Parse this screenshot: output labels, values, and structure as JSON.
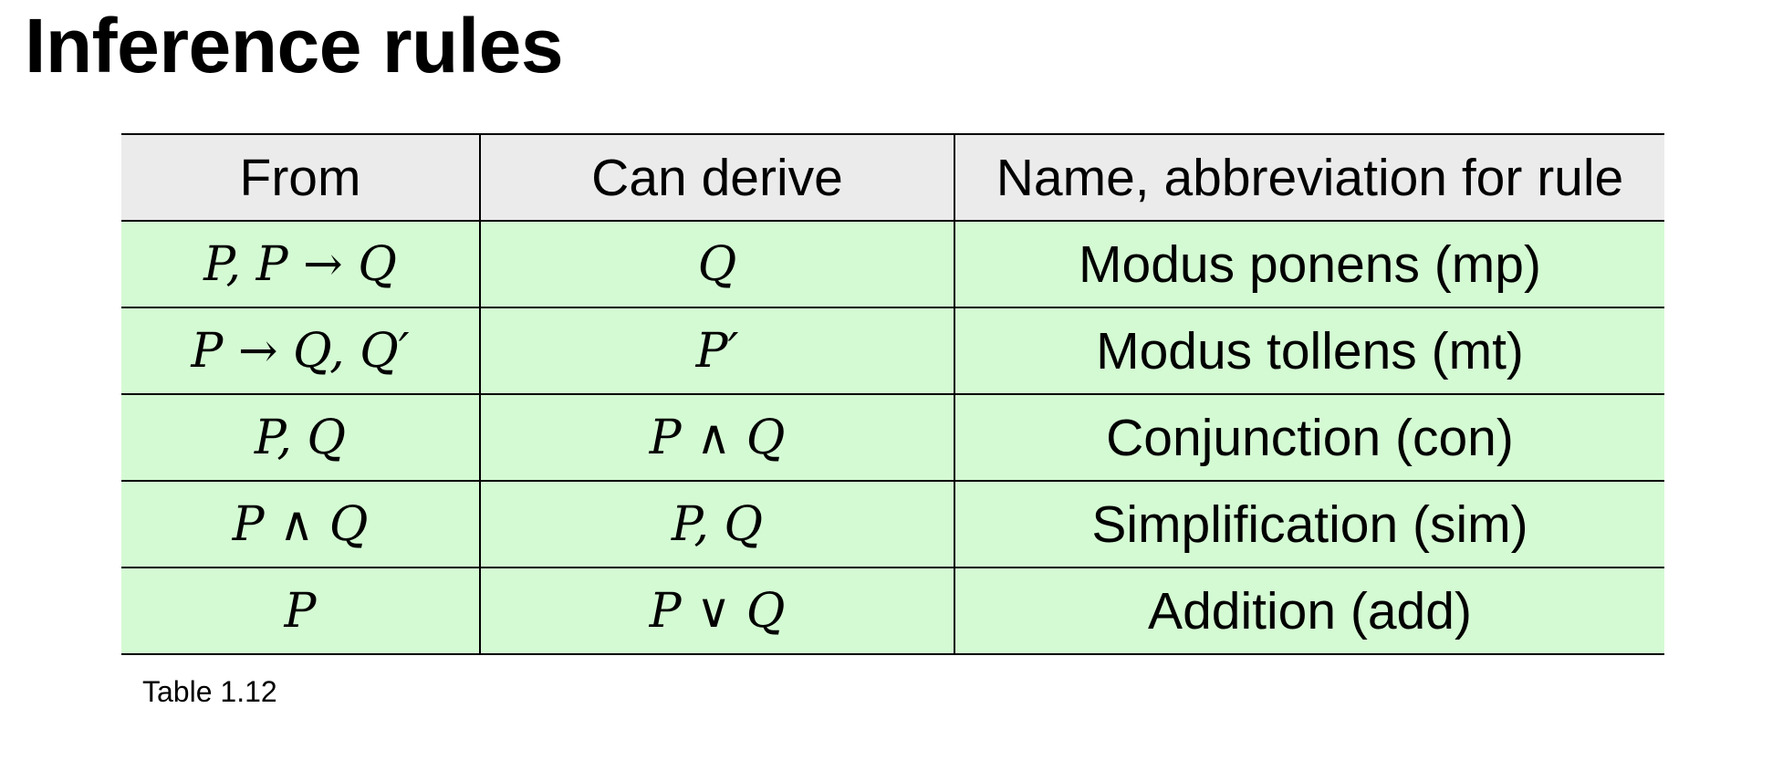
{
  "page": {
    "title": "Inference rules",
    "caption": "Table 1.12"
  },
  "table": {
    "headers": [
      "From",
      "Can derive",
      "Name, abbreviation for rule"
    ],
    "rows": [
      {
        "from": "P, P → Q",
        "derive": "Q",
        "name": "Modus ponens (mp)"
      },
      {
        "from": "P → Q, Q′",
        "derive": "P′",
        "name": "Modus tollens (mt)"
      },
      {
        "from": "P, Q",
        "derive": "P ∧ Q",
        "name": "Conjunction (con)"
      },
      {
        "from": "P ∧ Q",
        "derive": "P, Q",
        "name": "Simplification (sim)"
      },
      {
        "from": "P",
        "derive": "P ∨ Q",
        "name": "Addition (add)"
      }
    ]
  },
  "colors": {
    "header_background": "#ebebeb",
    "row_background": "#d4fad3",
    "border": "#000000",
    "text": "#000000"
  }
}
